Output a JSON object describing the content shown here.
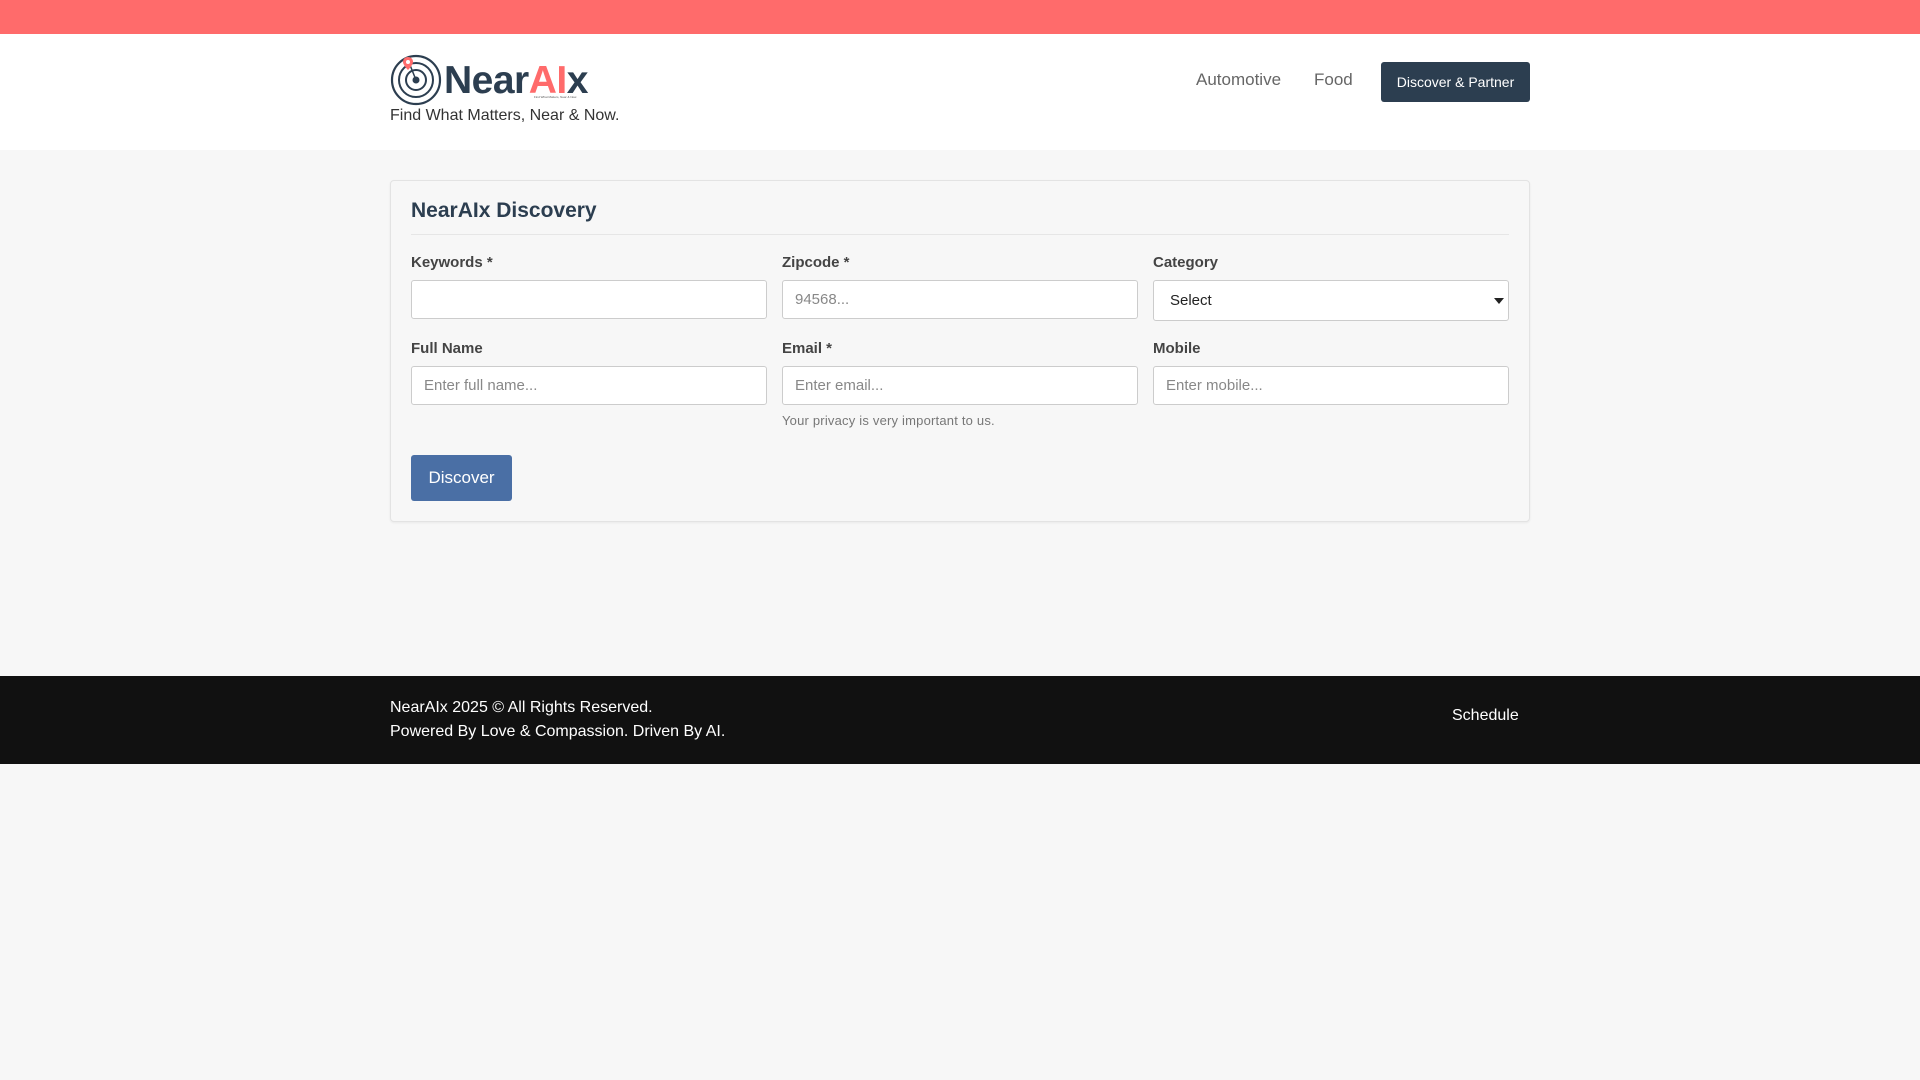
{
  "colors": {
    "top_bar": "#ff6b6b",
    "brand_dark": "#2c3e50",
    "brand_accent": "#ff6b6b",
    "primary_button": "#4a6fa5",
    "footer_bg": "#111111"
  },
  "header": {
    "logo": {
      "icon": "radar-target-icon",
      "text_near": "Near",
      "text_ai": "AI",
      "text_x": "x",
      "sub": "Find What Matters, Near & Now."
    },
    "tagline": "Find What Matters, Near & Now.",
    "nav": {
      "automotive": "Automotive",
      "food": "Food"
    },
    "partner_button": "Discover & Partner"
  },
  "form": {
    "title": "NearAIx Discovery",
    "keywords": {
      "label": "Keywords *",
      "value": "",
      "placeholder": ""
    },
    "zipcode": {
      "label": "Zipcode *",
      "placeholder": "94568..."
    },
    "category": {
      "label": "Category",
      "selected": "Select",
      "icon": "caret-down-icon"
    },
    "full_name": {
      "label": "Full Name",
      "placeholder": "Enter full name..."
    },
    "email": {
      "label": "Email *",
      "placeholder": "Enter email...",
      "help": "Your privacy is very important to us."
    },
    "mobile": {
      "label": "Mobile",
      "placeholder": "Enter mobile..."
    },
    "submit": "Discover"
  },
  "footer": {
    "copyright": "NearAIx 2025 © All Rights Reserved.",
    "powered": "Powered By Love & Compassion. Driven By AI.",
    "schedule": "Schedule"
  }
}
